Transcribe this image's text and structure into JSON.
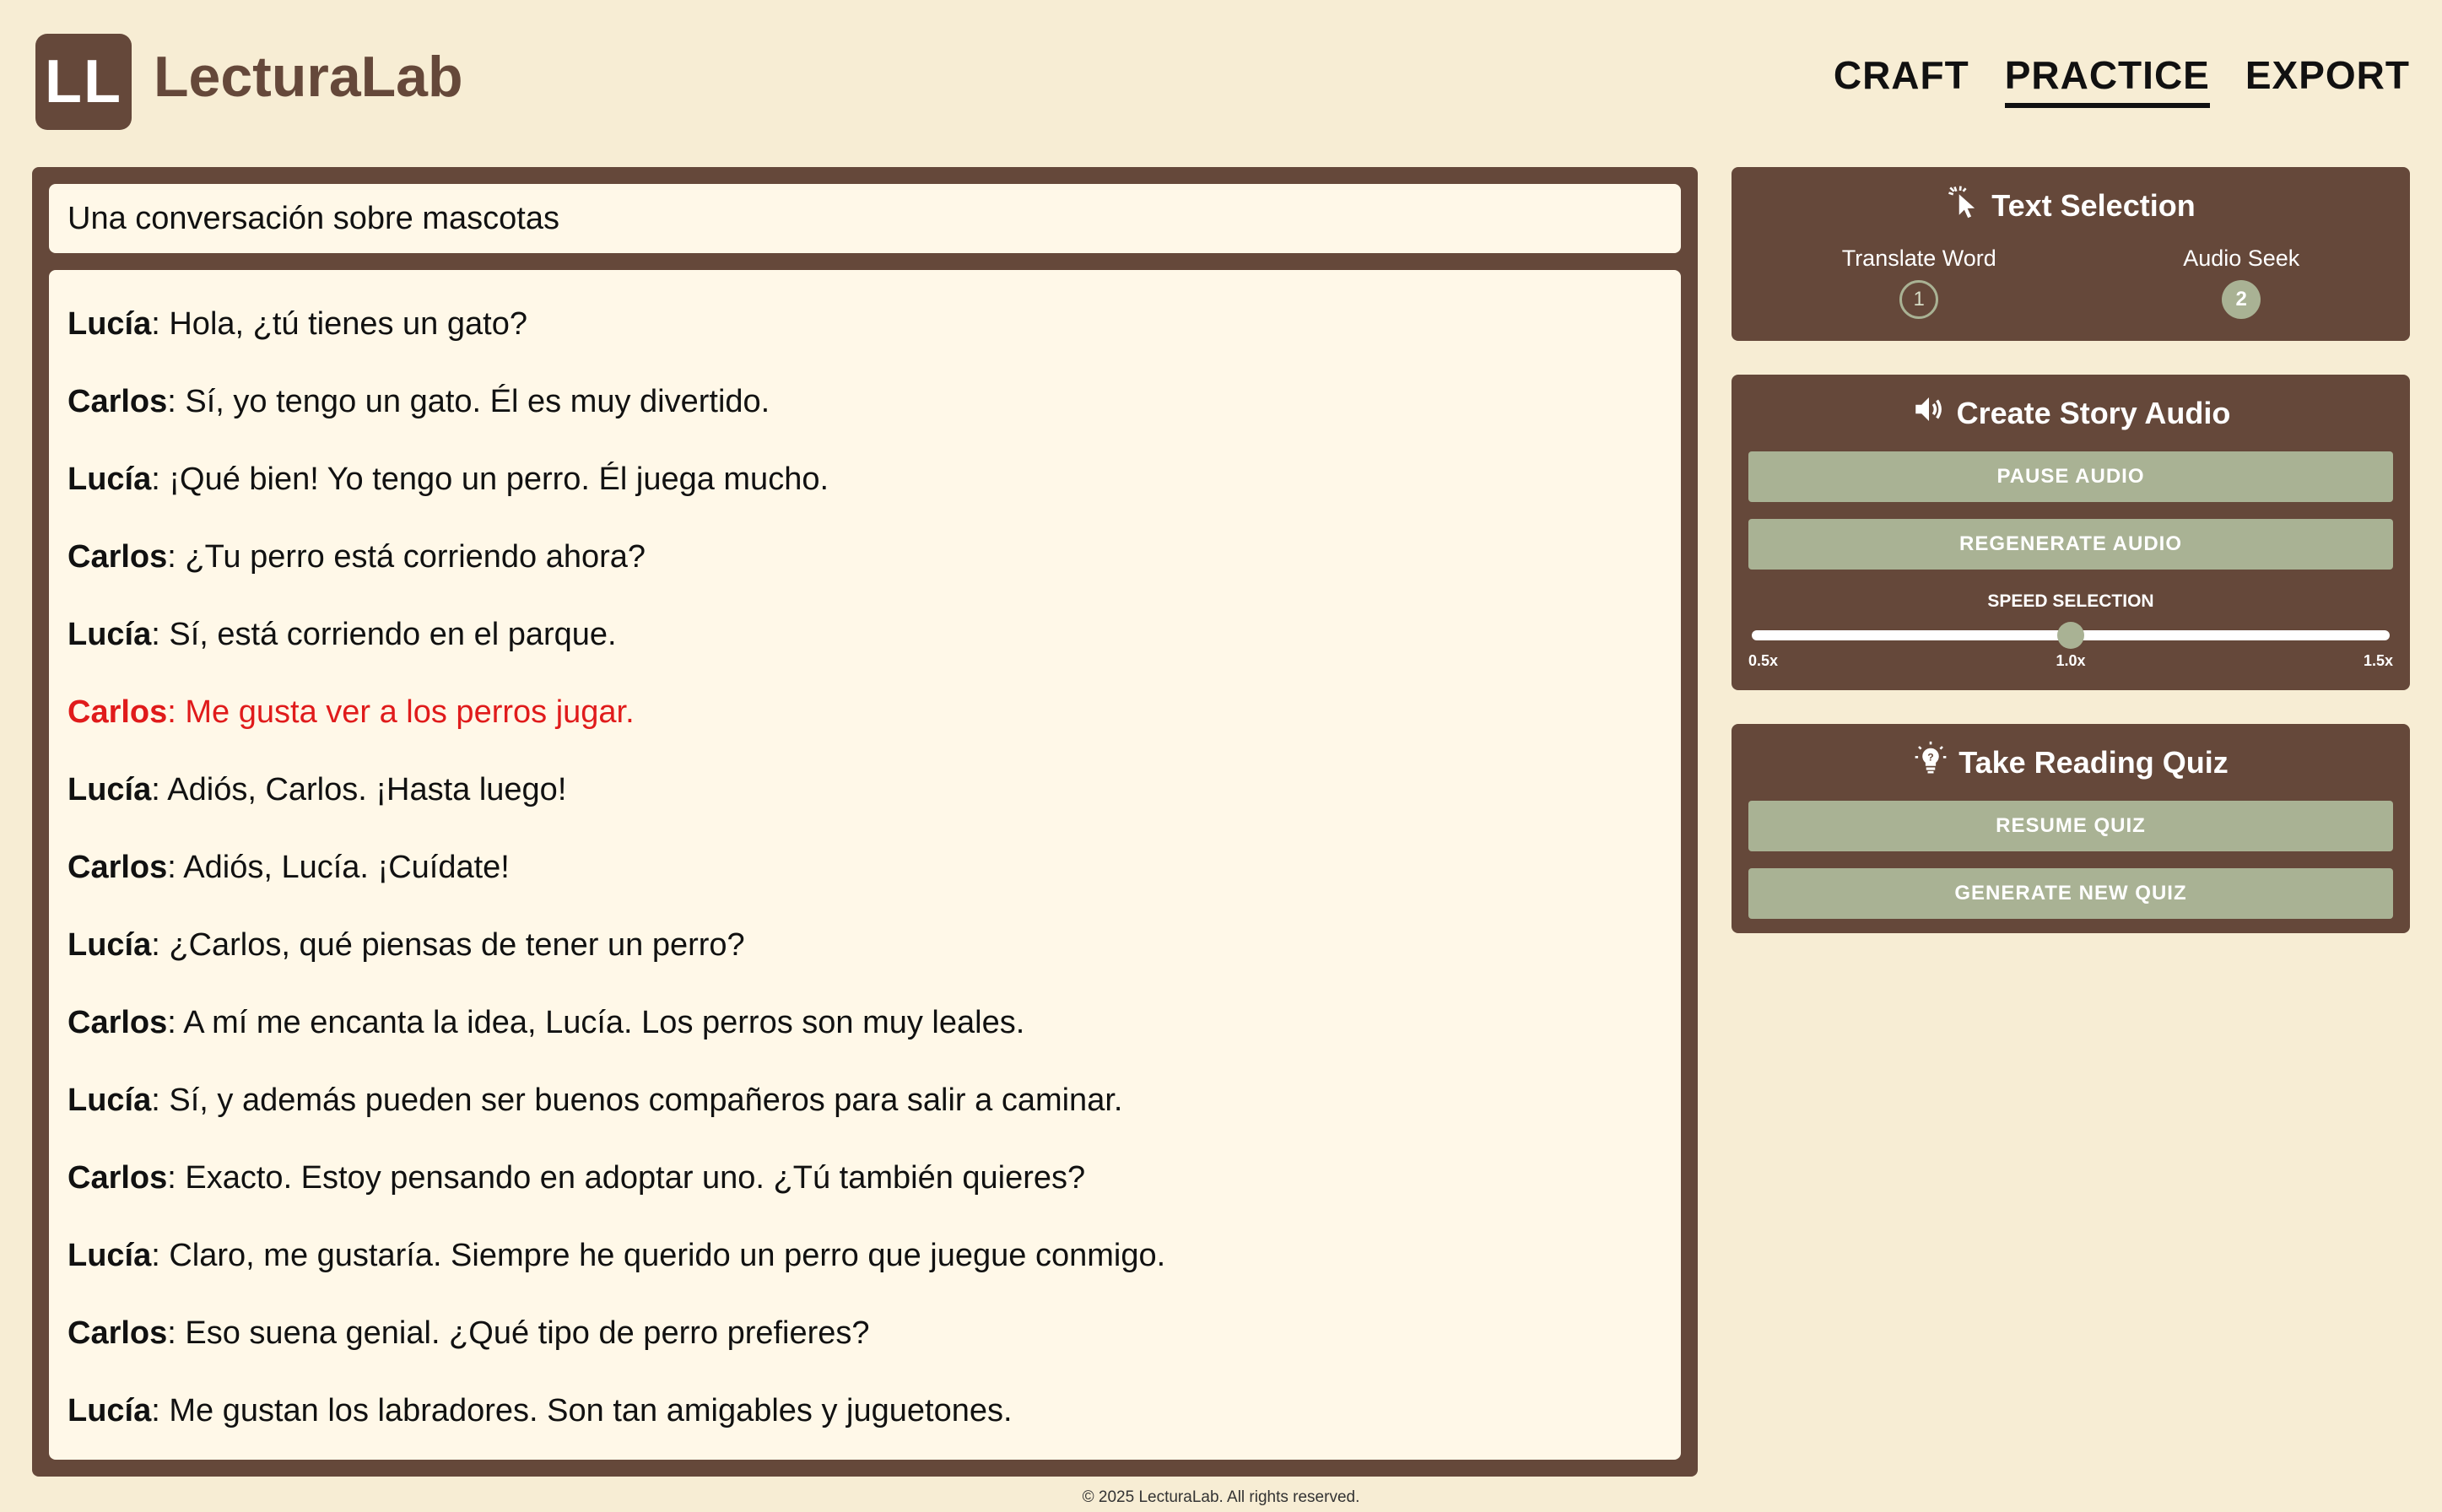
{
  "app": {
    "logo_text": "LL",
    "brand": "LecturaLab"
  },
  "nav": {
    "items": [
      {
        "label": "CRAFT"
      },
      {
        "label": "PRACTICE",
        "active": true
      },
      {
        "label": "EXPORT"
      }
    ]
  },
  "story": {
    "title": "Una conversación sobre mascotas",
    "highlight_color": "#e01b1b",
    "lines": [
      {
        "speaker": "Lucía",
        "text": ": Hola, ¿tú tienes un gato?"
      },
      {
        "speaker": "Carlos",
        "text": ": Sí, yo tengo un gato. Él es muy divertido."
      },
      {
        "speaker": "Lucía",
        "text": ": ¡Qué bien! Yo tengo un perro. Él juega mucho."
      },
      {
        "speaker": "Carlos",
        "text": ": ¿Tu perro está corriendo ahora?"
      },
      {
        "speaker": "Lucía",
        "text": ": Sí, está corriendo en el parque."
      },
      {
        "speaker": "Carlos",
        "text": ": Me gusta ver a los perros jugar.",
        "highlighted": true
      },
      {
        "speaker": "Lucía",
        "text": ": Adiós, Carlos. ¡Hasta luego!"
      },
      {
        "speaker": "Carlos",
        "text": ": Adiós, Lucía. ¡Cuídate!"
      },
      {
        "speaker": "Lucía",
        "text": ": ¿Carlos, qué piensas de tener un perro?"
      },
      {
        "speaker": "Carlos",
        "text": ": A mí me encanta la idea, Lucía. Los perros son muy leales."
      },
      {
        "speaker": "Lucía",
        "text": ": Sí, y además pueden ser buenos compañeros para salir a caminar."
      },
      {
        "speaker": "Carlos",
        "text": ": Exacto. Estoy pensando en adoptar uno. ¿Tú también quieres?"
      },
      {
        "speaker": "Lucía",
        "text": ": Claro, me gustaría. Siempre he querido un perro que juegue conmigo."
      },
      {
        "speaker": "Carlos",
        "text": ": Eso suena genial. ¿Qué tipo de perro prefieres?"
      },
      {
        "speaker": "Lucía",
        "text": ": Me gustan los labradores. Son tan amigables y juguetones."
      }
    ]
  },
  "text_selection": {
    "title": "Text Selection",
    "icon": "cursor-click-icon",
    "options": [
      {
        "label": "Translate Word",
        "step": "1",
        "selected": false
      },
      {
        "label": "Audio Seek",
        "step": "2",
        "selected": true
      }
    ]
  },
  "audio": {
    "title": "Create Story Audio",
    "icon": "speaker-icon",
    "pause_label": "PAUSE AUDIO",
    "regenerate_label": "REGENERATE AUDIO",
    "speed_label": "SPEED SELECTION",
    "speed_min": "0.5x",
    "speed_mid": "1.0x",
    "speed_max": "1.5x",
    "speed_value": 1.0
  },
  "quiz": {
    "title": "Take Reading Quiz",
    "icon": "lightbulb-icon",
    "resume_label": "RESUME QUIZ",
    "generate_label": "GENERATE NEW QUIZ"
  },
  "footer": {
    "text": "© 2025 LecturaLab. All rights reserved."
  }
}
